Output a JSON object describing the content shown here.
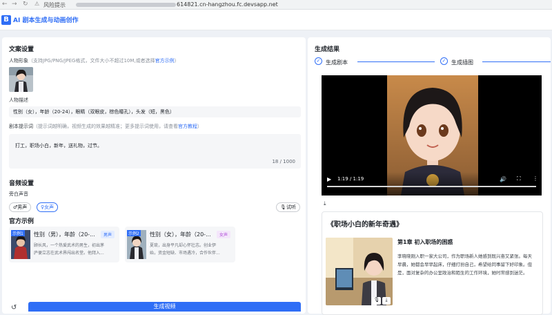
{
  "browser": {
    "risk_label": "风险提示",
    "host": "614821.cn-hangzhou.fc.devsapp.net"
  },
  "app": {
    "logo": "B",
    "title": "AI 剧本生成与动画创作"
  },
  "copy_settings": {
    "title": "文案设置",
    "character_label": "人物形象",
    "character_hint": "（支持JPG/PNG/JPEG格式，文件大小不超过10M,或者选择",
    "character_link": "官方示例",
    "character_hint_end": "）",
    "desc_label": "人物描述",
    "desc_value": "性别（女），年龄（20-24），眼睛（双眼皮，棕色瞳孔），头发（短，黑色）",
    "prompt_label": "剧本提示词",
    "prompt_hint": "（提示词越明确，视频生成的效果越精准；更多提示词使用，请查看",
    "prompt_link": "官方教程",
    "prompt_hint_end": "）",
    "prompt_value": "打工，职场小白，新年，送礼物，过节。",
    "prompt_count": "18 / 1000"
  },
  "audio_settings": {
    "title": "音频设置",
    "voice_label": "旁白声音",
    "male": "♂男声",
    "female": "♀女声",
    "audition": "🎙试听"
  },
  "official_examples": {
    "title": "官方示例",
    "items": [
      {
        "badge": "示例1",
        "title": "性别（男），年龄（20-...",
        "tag": "男声",
        "desc1": "顾长风，一个热爱武术的男生，初出茅",
        "desc2": "庐便立志在武术界闯出名堂。他拜入..."
      },
      {
        "badge": "示例2",
        "title": "性别（女），年龄（20-...",
        "tag": "女声",
        "desc1": "夏琉，出身平凡却心怀壮志。创业伊",
        "desc2": "始，资金短缺、市场遇冷，合作伙伴..."
      }
    ]
  },
  "actions": {
    "generate": "生成视频"
  },
  "results": {
    "title": "生成结果",
    "step1": "生成剧本",
    "step2": "生成插图",
    "video_time": "1:19 / 1:19",
    "story_title": "《职场小白的新年奇遇》",
    "chapter_title": "第1章 初入职场的困惑",
    "chapter_lines": [
      "李晓晓刚入职一家大公司，作为职场新人她感到既兴奋又紧张。每天",
      "早晨，她都会早早起床，仔细打扮自己，希望给同事留下好印象。但",
      "是，面对复杂的办公室政治和陌生的工作环境，她时常感到迷茫。"
    ]
  },
  "colors": {
    "accent": "#2f6ef6",
    "male_tag": "#2f6ef6",
    "female_tag": "#b04fd8"
  }
}
